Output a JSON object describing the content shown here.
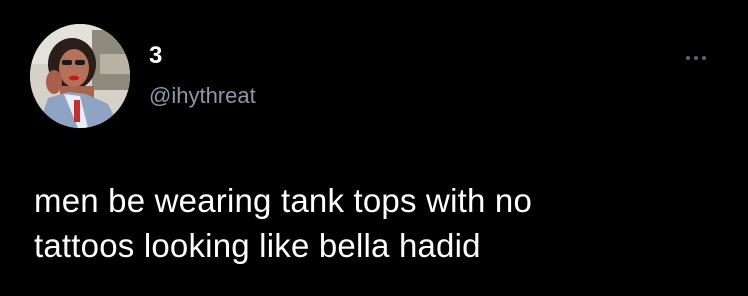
{
  "tweet": {
    "author": {
      "display_name": "3",
      "handle": "@ihythreat",
      "avatar_icon": "profile-photo"
    },
    "menu_icon": "more-dots-icon",
    "text_lines": [
      "men be wearing tank tops with no",
      "tattoos looking like bella hadid"
    ]
  },
  "colors": {
    "background": "#000000",
    "text": "#ffffff",
    "secondary_text": "#8b98a5"
  }
}
